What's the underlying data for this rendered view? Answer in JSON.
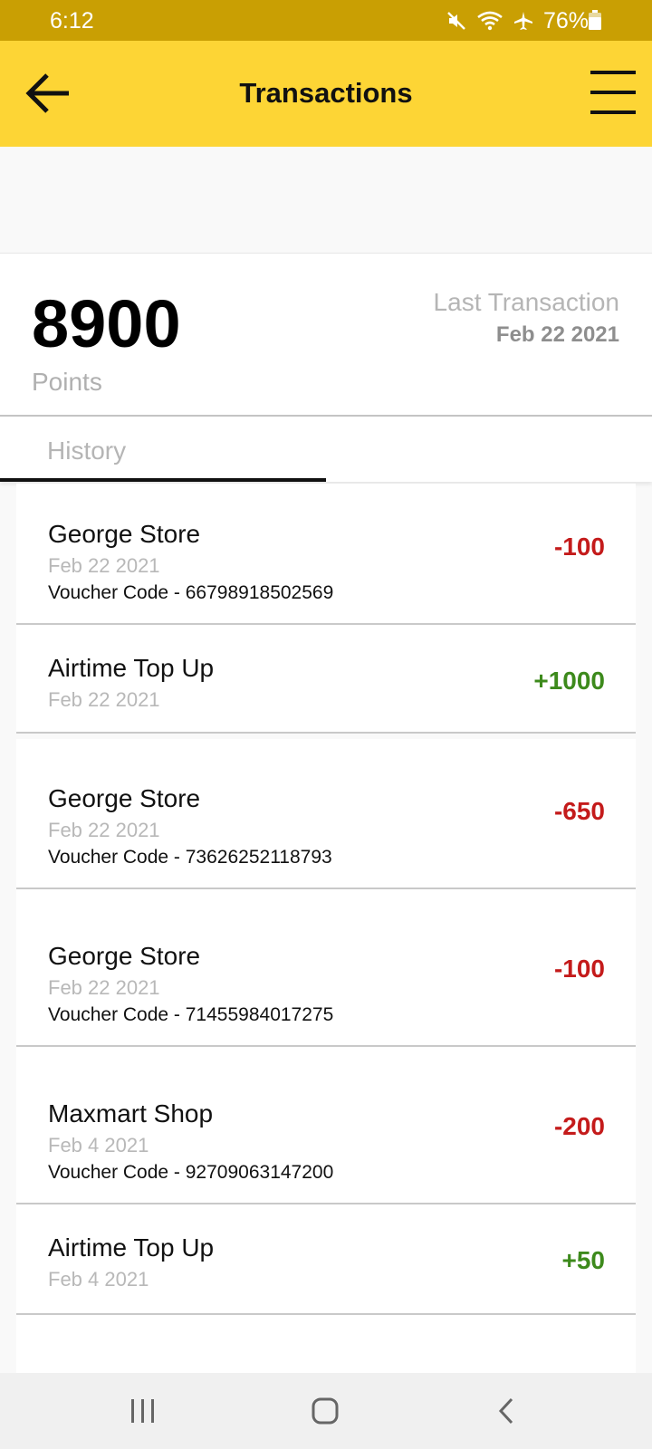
{
  "status_bar": {
    "time": "6:12",
    "battery": "76%",
    "icons": [
      "mute-icon",
      "wifi-icon",
      "airplane-icon",
      "battery-icon"
    ]
  },
  "header": {
    "title": "Transactions",
    "back_icon": "arrow-left-icon",
    "menu_icon": "hamburger-menu-icon",
    "color": "#fdd535"
  },
  "summary": {
    "points": "8900",
    "points_label": "Points",
    "last_transaction_label": "Last Transaction",
    "last_transaction_date": "Feb 22 2021"
  },
  "tabs": [
    {
      "label": "History",
      "active": true
    }
  ],
  "transactions": [
    {
      "name": "George Store",
      "date": "Feb 22 2021",
      "voucher": "Voucher Code - 66798918502569",
      "amount": "-100",
      "type": "debit"
    },
    {
      "name": "Airtime Top Up",
      "date": "Feb 22 2021",
      "voucher": "",
      "amount": "+1000",
      "type": "credit"
    },
    {
      "name": "George Store",
      "date": "Feb 22 2021",
      "voucher": "Voucher Code - 73626252118793",
      "amount": "-650",
      "type": "debit"
    },
    {
      "name": "George Store",
      "date": "Feb 22 2021",
      "voucher": "Voucher Code - 71455984017275",
      "amount": "-100",
      "type": "debit"
    },
    {
      "name": "Maxmart Shop",
      "date": "Feb 4 2021",
      "voucher": "Voucher Code - 92709063147200",
      "amount": "-200",
      "type": "debit"
    },
    {
      "name": "Airtime Top Up",
      "date": "Feb 4 2021",
      "voucher": "",
      "amount": "+50",
      "type": "credit"
    }
  ],
  "colors": {
    "debit": "#c41b1b",
    "credit": "#3d8a1c",
    "status_bar": "#c99f03"
  },
  "nav": {
    "icons": [
      "recent-apps-icon",
      "home-icon",
      "back-icon"
    ]
  }
}
